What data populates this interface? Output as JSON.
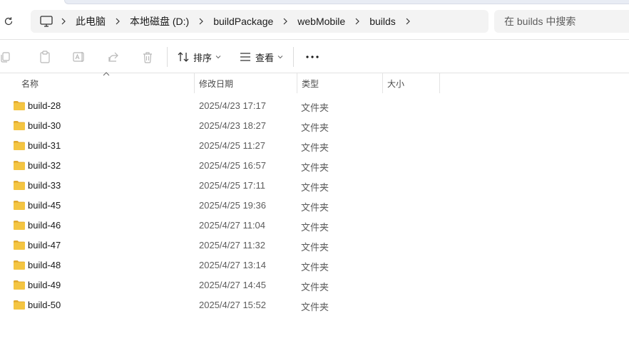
{
  "address": {
    "crumbs": [
      "此电脑",
      "本地磁盘 (D:)",
      "buildPackage",
      "webMobile",
      "builds"
    ]
  },
  "search": {
    "placeholder": "在 builds 中搜索"
  },
  "toolbar": {
    "sort_label": "排序",
    "view_label": "查看",
    "more_label": "•••"
  },
  "columns": {
    "name": "名称",
    "date": "修改日期",
    "type": "类型",
    "size": "大小"
  },
  "files": [
    {
      "name": "build-28",
      "date": "2025/4/23 17:17",
      "type": "文件夹"
    },
    {
      "name": "build-30",
      "date": "2025/4/23 18:27",
      "type": "文件夹"
    },
    {
      "name": "build-31",
      "date": "2025/4/25 11:27",
      "type": "文件夹"
    },
    {
      "name": "build-32",
      "date": "2025/4/25 16:57",
      "type": "文件夹"
    },
    {
      "name": "build-33",
      "date": "2025/4/25 17:11",
      "type": "文件夹"
    },
    {
      "name": "build-45",
      "date": "2025/4/25 19:36",
      "type": "文件夹"
    },
    {
      "name": "build-46",
      "date": "2025/4/27 11:04",
      "type": "文件夹"
    },
    {
      "name": "build-47",
      "date": "2025/4/27 11:32",
      "type": "文件夹"
    },
    {
      "name": "build-48",
      "date": "2025/4/27 13:14",
      "type": "文件夹"
    },
    {
      "name": "build-49",
      "date": "2025/4/27 14:45",
      "type": "文件夹"
    },
    {
      "name": "build-50",
      "date": "2025/4/27 15:52",
      "type": "文件夹"
    }
  ],
  "colors": {
    "folder": "#f4c542",
    "folder_dark": "#e0a82e"
  }
}
